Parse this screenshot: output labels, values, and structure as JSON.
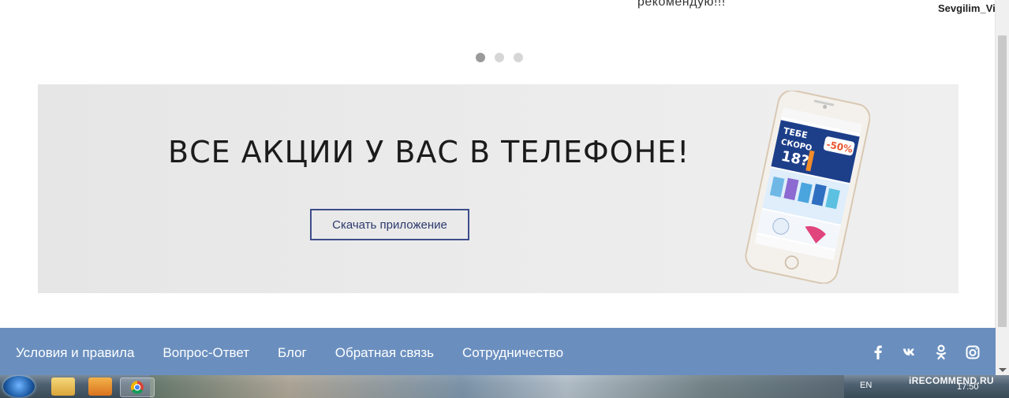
{
  "review": {
    "top_text": "рекомендую!!!",
    "username": "Sevgilim_Viki"
  },
  "carousel": {
    "dots": 3,
    "active_index": 0
  },
  "banner": {
    "title": "ВСЕ АКЦИИ У ВАС В ТЕЛЕФОНЕ!",
    "button_label": "Скачать приложение",
    "phone_screen": {
      "headline_1": "ТЕБЕ",
      "headline_2": "СКОРО",
      "headline_3": "18?",
      "discount": "-50%"
    }
  },
  "footer": {
    "links": [
      "Условия и правила",
      "Вопрос-Ответ",
      "Блог",
      "Обратная связь",
      "Сотрудничество"
    ],
    "social_icons": [
      "facebook-icon",
      "vk-icon",
      "odnoklassniki-icon",
      "instagram-icon"
    ],
    "social_glyphs": [
      "f",
      "vk",
      "ok",
      "ig"
    ]
  },
  "taskbar": {
    "language": "EN",
    "time": "17:50"
  },
  "watermark": "iRECOMMEND.RU",
  "colors": {
    "footer_bg": "#6a8fbf",
    "button_border": "#3d4d8a",
    "banner_bg": "#e8e8e8"
  }
}
